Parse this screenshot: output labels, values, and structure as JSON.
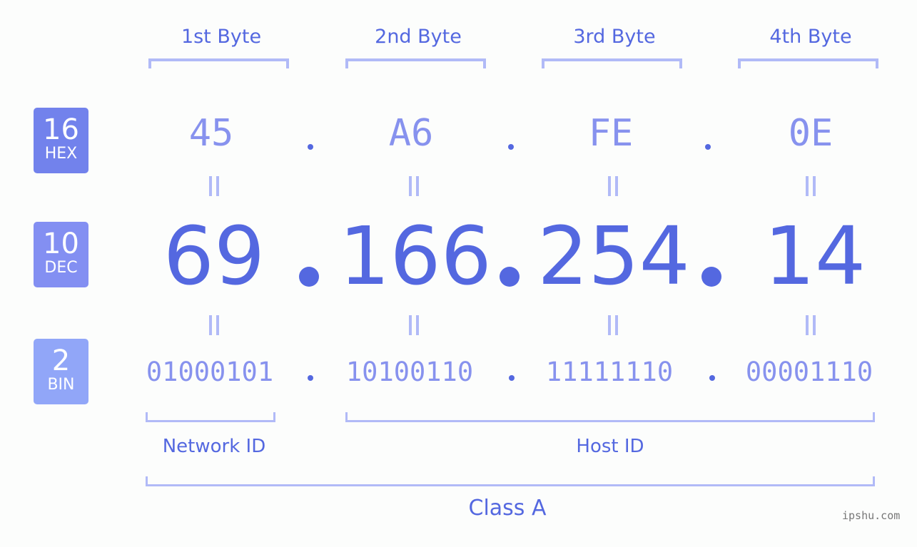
{
  "badges": [
    {
      "base": "16",
      "label": "HEX",
      "color": "#7282ec"
    },
    {
      "base": "10",
      "label": "DEC",
      "color": "#838ff2"
    },
    {
      "base": "2",
      "label": "BIN",
      "color": "#91a6f8"
    }
  ],
  "byte_headers": [
    "1st Byte",
    "2nd Byte",
    "3rd Byte",
    "4th Byte"
  ],
  "hex": [
    "45",
    "A6",
    "FE",
    "0E"
  ],
  "dec": [
    "69",
    "166",
    "254",
    "14"
  ],
  "bin": [
    "01000101",
    "10100110",
    "11111110",
    "00001110"
  ],
  "groups": {
    "network_id": "Network ID",
    "host_id": "Host ID",
    "class": "Class A"
  },
  "watermark": "ipshu.com",
  "colors": {
    "accent": "#5468e0",
    "light_value": "#8792ee",
    "bracket": "#b1baf7"
  }
}
